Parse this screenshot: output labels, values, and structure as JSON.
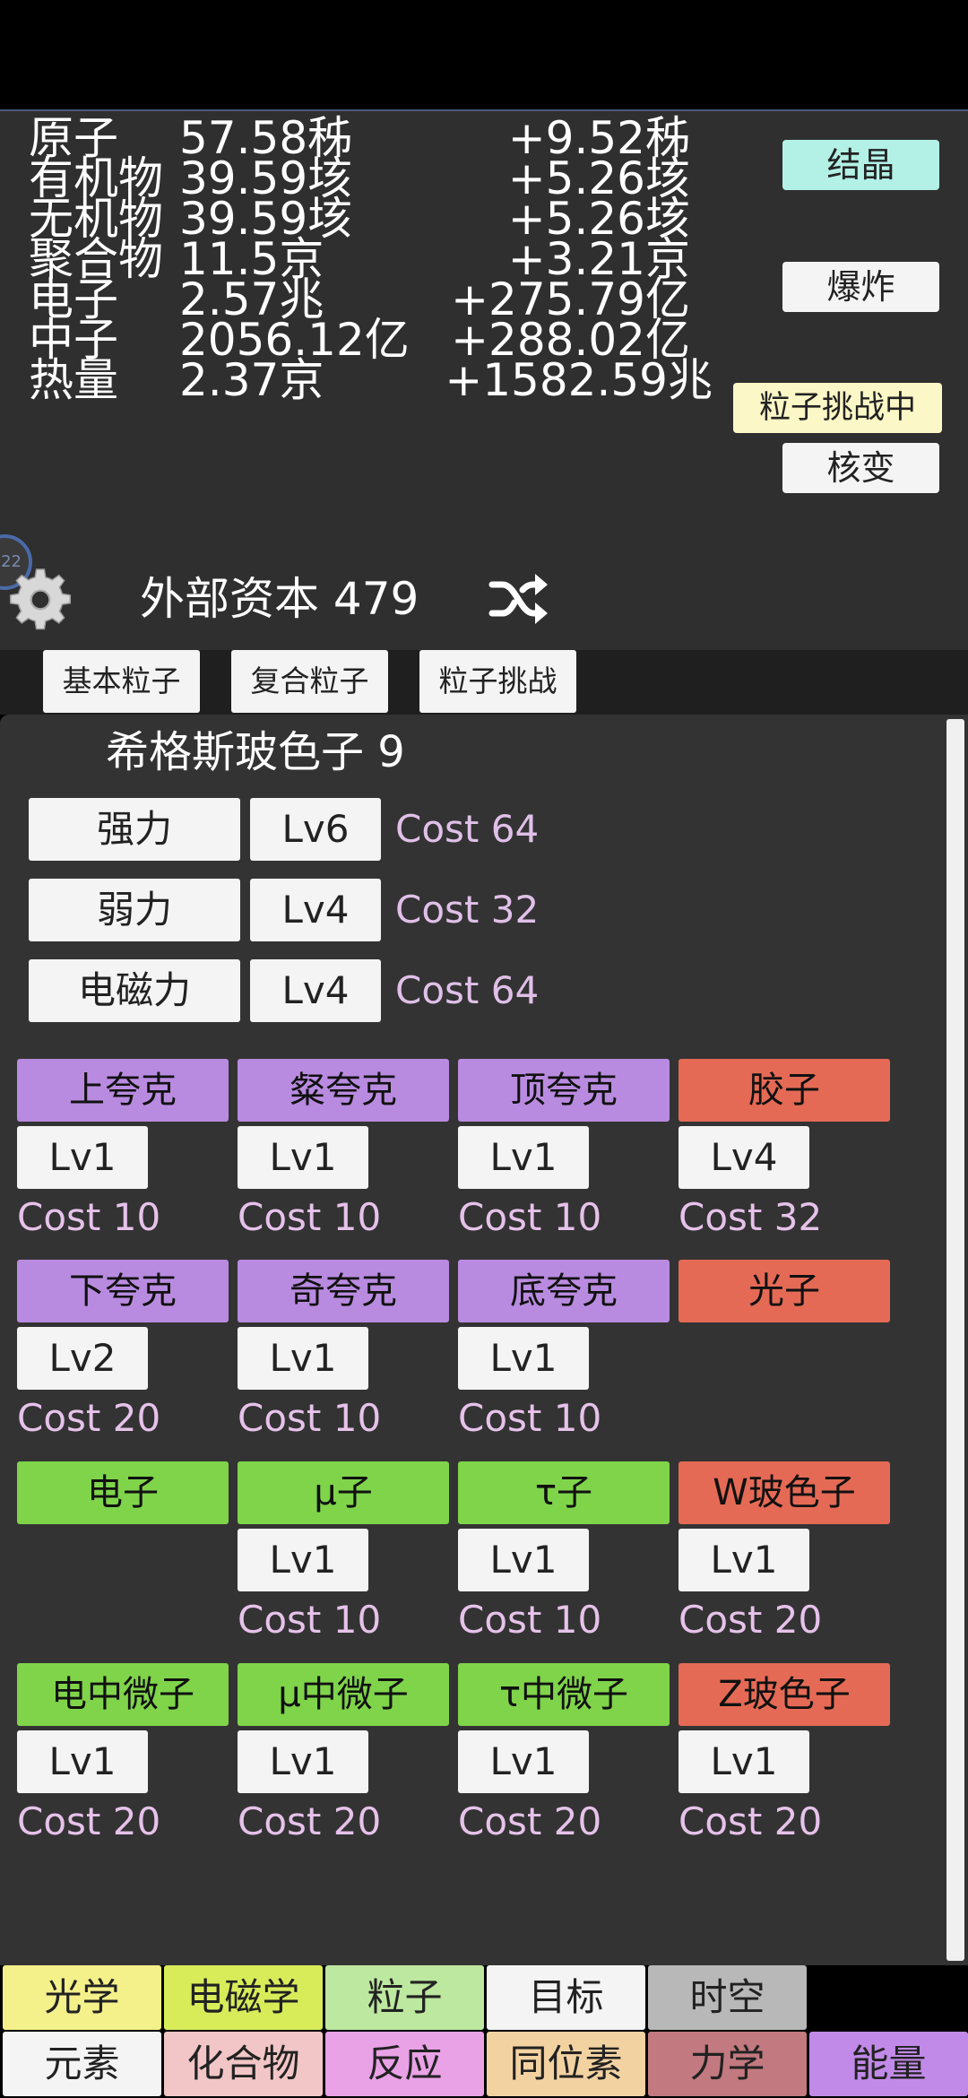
{
  "resources": [
    {
      "name": "原子",
      "value": "57.58秭",
      "rate": "+9.52秭"
    },
    {
      "name": "有机物",
      "value": "39.59垓",
      "rate": "+5.26垓"
    },
    {
      "name": "无机物",
      "value": "39.59垓",
      "rate": "+5.26垓"
    },
    {
      "name": "聚合物",
      "value": "11.5京",
      "rate": "+3.21京"
    },
    {
      "name": "电子",
      "value": "2.57兆",
      "rate": "+275.79亿"
    },
    {
      "name": "中子",
      "value": "2056.12亿",
      "rate": "+288.02亿"
    },
    {
      "name": "热量",
      "value": "2.37京",
      "rate": "+1582.59兆"
    }
  ],
  "side_buttons": {
    "crystal": "结晶",
    "explode": "爆炸",
    "challenge_active": "粒子挑战中",
    "fission": "核变"
  },
  "capital_label": "外部资本 479",
  "edge_badge": "22",
  "tabs": [
    "基本粒子",
    "复合粒子",
    "粒子挑战"
  ],
  "higgs_label": "希格斯玻色子 9",
  "forces": [
    {
      "name": "强力",
      "level": "Lv6",
      "cost": "Cost 64"
    },
    {
      "name": "弱力",
      "level": "Lv4",
      "cost": "Cost 32"
    },
    {
      "name": "电磁力",
      "level": "Lv4",
      "cost": "Cost 64"
    }
  ],
  "particles": [
    [
      {
        "name": "上夸克",
        "level": "Lv1",
        "cost": "Cost 10",
        "color": "#b98be0"
      },
      {
        "name": "粲夸克",
        "level": "Lv1",
        "cost": "Cost 10",
        "color": "#b98be0"
      },
      {
        "name": "顶夸克",
        "level": "Lv1",
        "cost": "Cost 10",
        "color": "#b98be0"
      },
      {
        "name": "胶子",
        "level": "Lv4",
        "cost": "Cost 32",
        "color": "#e56a55"
      }
    ],
    [
      {
        "name": "下夸克",
        "level": "Lv2",
        "cost": "Cost 20",
        "color": "#b98be0"
      },
      {
        "name": "奇夸克",
        "level": "Lv1",
        "cost": "Cost 10",
        "color": "#b98be0"
      },
      {
        "name": "底夸克",
        "level": "Lv1",
        "cost": "Cost 10",
        "color": "#b98be0"
      },
      {
        "name": "光子",
        "level": "",
        "cost": "",
        "color": "#e56a55"
      }
    ],
    [
      {
        "name": "电子",
        "level": "",
        "cost": "",
        "color": "#7fd44a"
      },
      {
        "name": "μ子",
        "level": "Lv1",
        "cost": "Cost 10",
        "color": "#7fd44a"
      },
      {
        "name": "τ子",
        "level": "Lv1",
        "cost": "Cost 10",
        "color": "#7fd44a"
      },
      {
        "name": "W玻色子",
        "level": "Lv1",
        "cost": "Cost 20",
        "color": "#e56a55"
      }
    ],
    [
      {
        "name": "电中微子",
        "level": "Lv1",
        "cost": "Cost 20",
        "color": "#7fd44a"
      },
      {
        "name": "μ中微子",
        "level": "Lv1",
        "cost": "Cost 20",
        "color": "#7fd44a"
      },
      {
        "name": "τ中微子",
        "level": "Lv1",
        "cost": "Cost 20",
        "color": "#7fd44a"
      },
      {
        "name": "Z玻色子",
        "level": "Lv1",
        "cost": "Cost 20",
        "color": "#e56a55"
      }
    ]
  ],
  "nav_row1": [
    {
      "label": "光学",
      "color": "#f4f08a"
    },
    {
      "label": "电磁学",
      "color": "#d8ec5a"
    },
    {
      "label": "粒子",
      "color": "#bde8a0"
    },
    {
      "label": "目标",
      "color": "#f4f4f4"
    },
    {
      "label": "时空",
      "color": "#b8b8b8"
    }
  ],
  "nav_row2": [
    {
      "label": "元素",
      "color": "#f4f4f4"
    },
    {
      "label": "化合物",
      "color": "#f2c6c6"
    },
    {
      "label": "反应",
      "color": "#e9a2e6"
    },
    {
      "label": "同位素",
      "color": "#f3d2a2"
    },
    {
      "label": "力学",
      "color": "#c2797f"
    },
    {
      "label": "能量",
      "color": "#c28ae8"
    }
  ]
}
